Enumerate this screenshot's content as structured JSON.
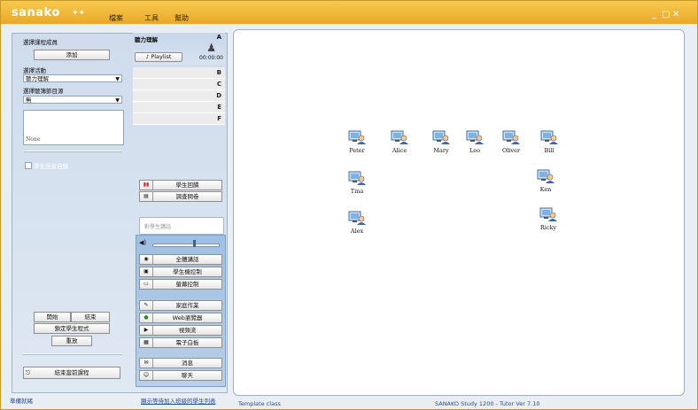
{
  "window": {
    "logo": "sanako",
    "menu": [
      "檔案",
      "工具",
      "幫助"
    ]
  },
  "left_panel": {
    "select_members_label": "選擇課程成員",
    "add_button": "添加",
    "select_activity_label": "選擇活動",
    "activity_value": "聽力理解",
    "select_playlist_label": "選擇聽簿節目源",
    "playlist_value": "無",
    "source_none": "None",
    "auto_repeat_label": "學生語音自錄",
    "start_button": "開始",
    "end_button": "結束",
    "lock_program_button": "鎖定學生程式",
    "replay_button": "重放",
    "end_session_button": "結束當前課程"
  },
  "activity_panel": {
    "title": "聽力理解",
    "corner_a": "A",
    "playlist_button": "Playlist",
    "time": "00:00:00",
    "rows": [
      "B",
      "C",
      "D",
      "E",
      "F"
    ]
  },
  "actions": {
    "student_reply": "學生回饋",
    "survey": "調查問卷",
    "speech_placeholder": "對學生講話",
    "all_speak": "全體講話",
    "student_control": "學生機控制",
    "screen_control": "螢幕控制",
    "homework": "家庭作業",
    "web_browser": "Web瀏覽器",
    "video_stream": "視頻流",
    "whiteboard": "電子白板",
    "message": "消息",
    "chat": "聊天"
  },
  "students": [
    {
      "name": "Peter"
    },
    {
      "name": "Alice"
    },
    {
      "name": "Mary"
    },
    {
      "name": "Leo"
    },
    {
      "name": "Oliver"
    },
    {
      "name": "Bill"
    },
    {
      "name": "Tina"
    },
    {
      "name": "Ken"
    },
    {
      "name": "Alex"
    },
    {
      "name": "Ricky"
    }
  ],
  "statusbar": {
    "ready": "準備就緒",
    "add_students_link": "顯示等待加入班級的學生列表",
    "template": "Template class",
    "version": "SANAKO Study 1200 - Tutor Ver 7.10"
  },
  "colors": {
    "title_bar": "#eeb036",
    "panel_blue": "#b8cde6"
  }
}
